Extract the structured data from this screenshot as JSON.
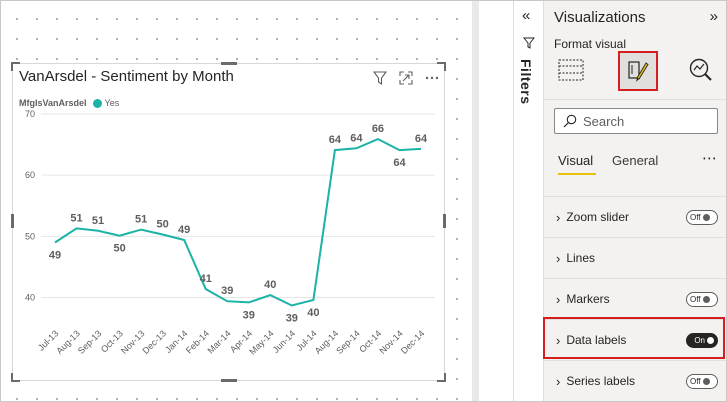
{
  "visual": {
    "title": "VanArsdel - Sentiment by Month",
    "legend_title": "MfgIsVanArsdel",
    "legend_item": "Yes",
    "icons": [
      "filter-icon",
      "focus-mode-icon",
      "more-options-icon"
    ]
  },
  "chart_data": {
    "type": "line",
    "title": "VanArsdel - Sentiment by Month",
    "categories": [
      "Jul-13",
      "Aug-13",
      "Sep-13",
      "Oct-13",
      "Nov-13",
      "Dec-13",
      "Jan-14",
      "Feb-14",
      "Mar-14",
      "Apr-14",
      "May-14",
      "Jun-14",
      "Jul-14",
      "Aug-14",
      "Sep-14",
      "Oct-14",
      "Nov-14",
      "Dec-14"
    ],
    "series": [
      {
        "name": "Yes",
        "color": "#1ab3a6",
        "values": [
          49,
          51.3,
          50.9,
          50.1,
          51.1,
          50.3,
          49.4,
          41.4,
          39.4,
          39.2,
          40.4,
          38.7,
          39.6,
          64.1,
          64.4,
          65.9,
          64.1,
          64.3
        ],
        "labels": [
          "49",
          "51",
          "51",
          "50",
          "51",
          "50",
          "49",
          "41",
          "39",
          "39",
          "40",
          "39",
          "40",
          "64",
          "64",
          "66",
          "64",
          "64"
        ]
      }
    ],
    "yticks": [
      40,
      50,
      60,
      70
    ],
    "ylim": [
      36,
      70
    ],
    "grid": true,
    "legend": "top-left"
  },
  "filters": {
    "label": "Filters",
    "collapse_icon": "double-chevron-left-icon"
  },
  "viz_pane": {
    "title": "Visualizations",
    "subtitle": "Format visual",
    "search_placeholder": "Search",
    "tabs": {
      "visual": "Visual",
      "general": "General",
      "more": "⋯"
    },
    "sections": [
      {
        "label": "Zoom slider",
        "toggle": "Off"
      },
      {
        "label": "Lines",
        "toggle": null
      },
      {
        "label": "Markers",
        "toggle": "Off"
      },
      {
        "label": "Data labels",
        "toggle": "On"
      },
      {
        "label": "Series labels",
        "toggle": "Off"
      }
    ]
  },
  "colors": {
    "series": "#1ab3a6",
    "highlight": "#d41f1f",
    "accent_tab": "#e8c00e"
  }
}
